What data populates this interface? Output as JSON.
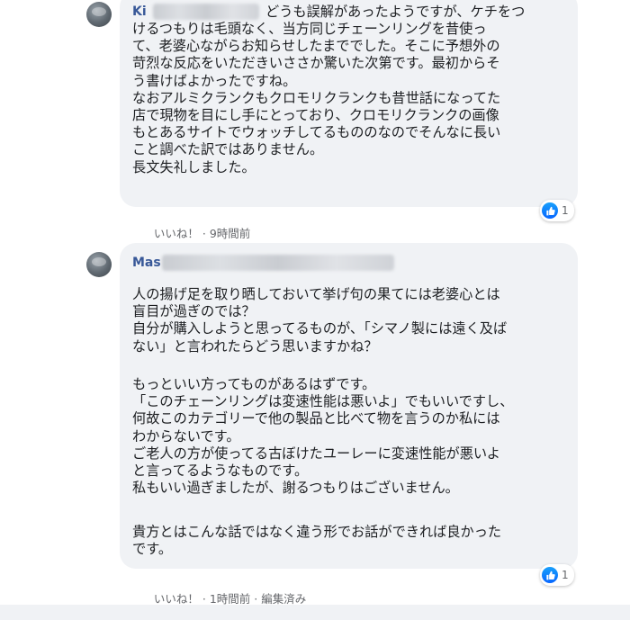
{
  "comments": [
    {
      "author_visible": "Ki",
      "text": "どうも誤解があったようですが、ケチをつ\nけるつもりは毛頭なく、当方同じチェーンリングを昔使っ\nて、老婆心ながらお知らせしたまででした。そこに予想外の\n苛烈な反応をいただきいささか驚いた次第です。最初からそ\nう書けばよかったですね。\nなおアルミクランクもクロモリクランクも昔世話になってた\n店で現物を目にし手にとっており、クロモリクランクの画像\nもとあるサイトでウォッチしてるもののなのでそんなに長い\nこと調べた訳ではありません。\n長文失礼しました。",
      "like_label": "いいね！",
      "separator": "·",
      "time": "9時間前",
      "reaction_count": "1"
    },
    {
      "author_visible": "Mas",
      "paragraphs": [
        "人の揚げ足を取り晒しておいて挙げ句の果てには老婆心とは\n盲目が過ぎのでは？\n自分が購入しようと思ってるものが、「シマノ製には遠く及ば\nない」と言われたらどう思いますかね？",
        "もっといい方ってものがあるはずです。\n「このチェーンリングは変速性能は悪いよ」でもいいですし、\n何故このカテゴリーで他の製品と比べて物を言うのか私には\nわからないです。\nご老人の方が使ってる古ぼけたユーレーに変速性能が悪いよ\nと言ってるようなものです。\n私もいい過ぎましたが、謝るつもりはございません。",
        "貴方とはこんな話ではなく違う形でお話ができれば良かった\nです。"
      ],
      "like_label": "いいね！",
      "separator": "·",
      "time": "1時間前",
      "edited": "編集済み",
      "reaction_count": "1"
    }
  ],
  "colors": {
    "bubble": "#f0f2f5",
    "author": "#385898",
    "like_blue": "#0866ff",
    "meta_text": "#65676b"
  },
  "icons": [
    "avatar",
    "like-thumb-icon"
  ]
}
